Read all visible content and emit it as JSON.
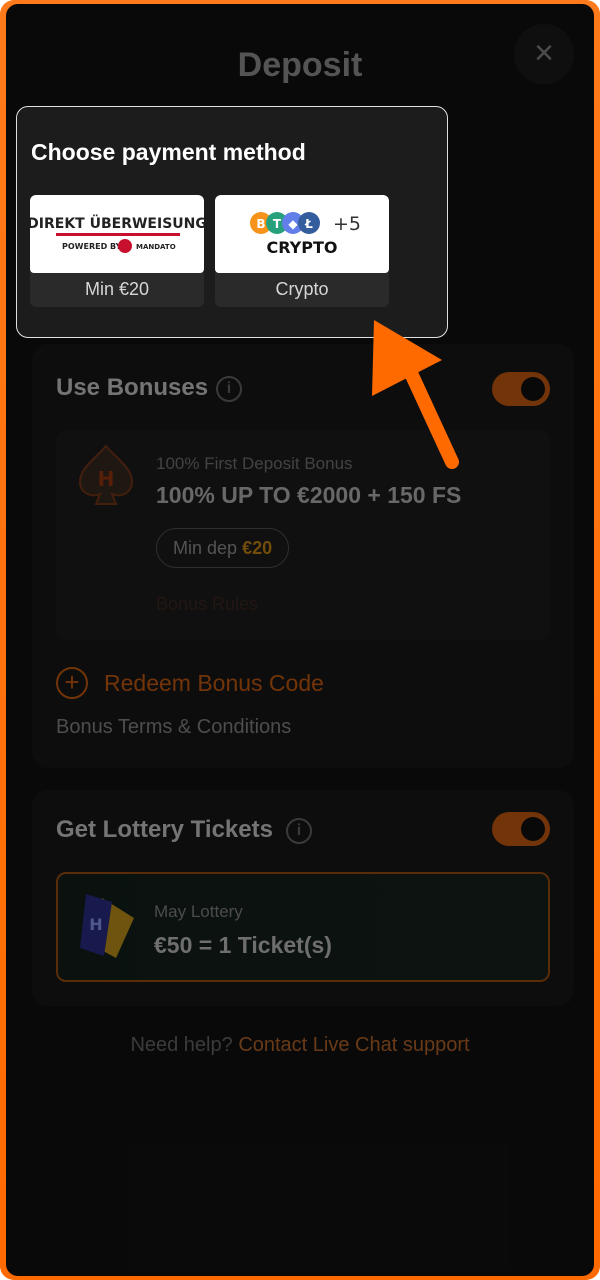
{
  "header": {
    "title": "Deposit",
    "close_glyph": "×"
  },
  "payment_popup": {
    "title": "Choose payment method",
    "methods": [
      {
        "label": "Min €20",
        "logo_line1": "DIREKT ÜBERWEISUNG",
        "logo_line2": "POWERED BY",
        "logo_brand": "MANDATO"
      },
      {
        "label": "Crypto",
        "logo_plus": "+5",
        "logo_text": "CRYPTO"
      }
    ]
  },
  "bonuses": {
    "title": "Use Bonuses",
    "toggle_on": true,
    "bonus": {
      "subtitle": "100% First Deposit Bonus",
      "headline": "100% UP TO €2000 + 150 FS",
      "min_dep_label": "Min dep",
      "min_dep_amount": "€20",
      "rules_text": "Bonus Rules"
    },
    "redeem_label": "Redeem Bonus Code",
    "terms_label": "Bonus Terms & Conditions"
  },
  "lottery": {
    "title": "Get Lottery Tickets",
    "toggle_on": true,
    "subtitle": "May Lottery",
    "headline": "€50 = 1 Ticket(s)"
  },
  "help": {
    "question": "Need help?",
    "link": "Contact Live Chat support"
  },
  "colors": {
    "accent": "#ff6a00",
    "toggle": "#d06010",
    "background": "#121212"
  }
}
